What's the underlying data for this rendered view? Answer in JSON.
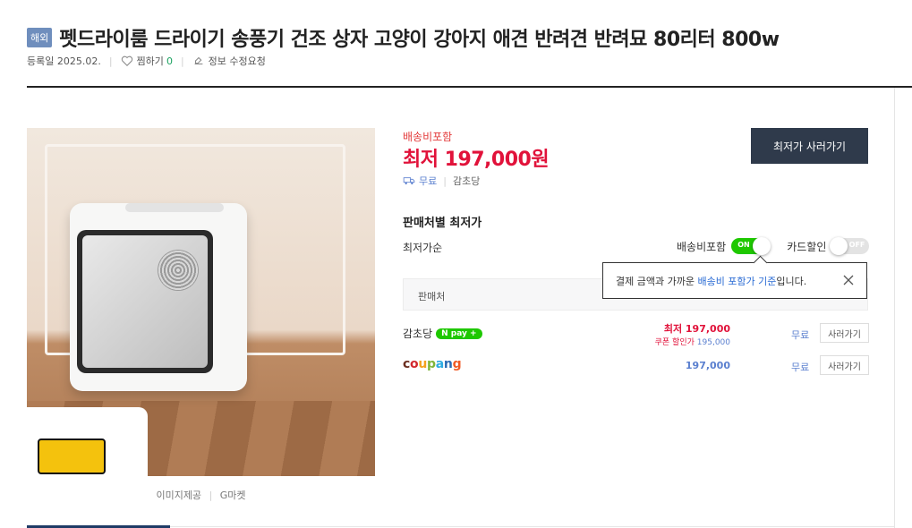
{
  "header": {
    "badge": "해외",
    "title": "펫드라이룸 드라이기 송풍기 건조 상자 고양이 강아지 애견 반려견 반려묘 80리터 800w",
    "reg_date": "등록일 2025.02.",
    "wish_label": "찜하기",
    "wish_count": "0",
    "edit_label": "정보 수정요청"
  },
  "image": {
    "caption_provider": "이미지제공",
    "caption_store": "G마켓"
  },
  "price_box": {
    "shipping_label": "배송비포함",
    "price": "최저 197,000원",
    "free_shipping": "무료",
    "seller": "감초당",
    "buy_button": "최저가 사러가기"
  },
  "sellers_section": {
    "title": "판매처별 최저가",
    "sort_label": "최저가순",
    "toggle_shipping_label": "배송비포함",
    "toggle_shipping_state": "ON",
    "toggle_card_label": "카드할인",
    "toggle_card_state": "OFF",
    "table_header_seller": "판매처",
    "tooltip_pre": "결제 금액과 가까운 ",
    "tooltip_blue": "배송비 포함가 기준",
    "tooltip_post": "입니다.",
    "rows": [
      {
        "seller": "감초당",
        "pay_badge": "N pay +",
        "price_label": "최저 197,000",
        "coupon_label": "쿠폰 할인가",
        "coupon_price": "195,000",
        "shipping": "무료",
        "button": "사러가기"
      },
      {
        "seller": "coupang",
        "price": "197,000",
        "shipping": "무료",
        "button": "사러가기"
      }
    ]
  },
  "colors": {
    "price_red": "#e1123a",
    "link_blue": "#5a7fcf",
    "naver_green": "#1ec800",
    "buy_button_bg": "#2f3a4b"
  }
}
